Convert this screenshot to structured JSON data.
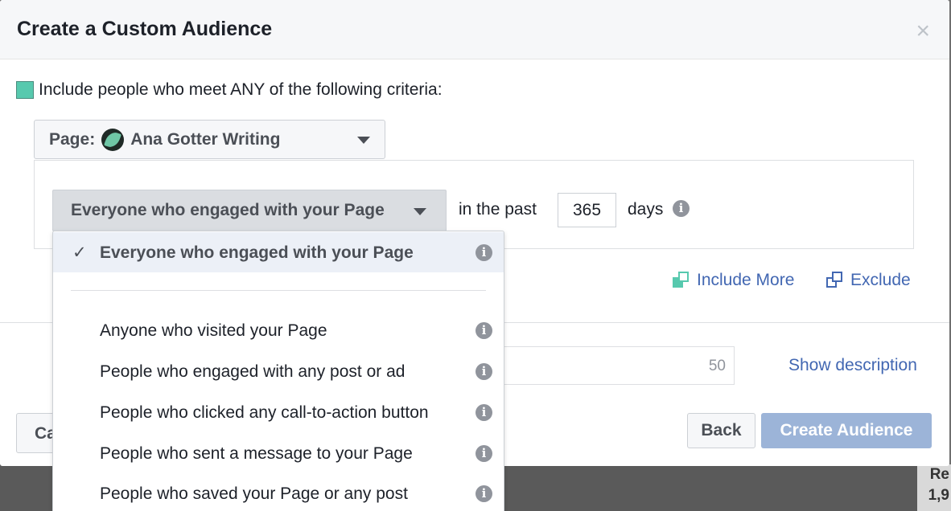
{
  "dialog": {
    "title": "Create a Custom Audience",
    "close_symbol": "×"
  },
  "criteria": {
    "text": "Include people who meet ANY of the following criteria:"
  },
  "page_select": {
    "label": "Page:",
    "page_name": "Ana Gotter Writing"
  },
  "engagement": {
    "selected": "Everyone who engaged with your Page",
    "in_the_past": "in the past",
    "days_value": "365",
    "days_label": "days"
  },
  "links": {
    "include_more": "Include More",
    "exclude": "Exclude"
  },
  "name_field": {
    "char_limit": "50"
  },
  "show_description": "Show description",
  "footer": {
    "cancel_label": "Ca",
    "back_label": "Back",
    "create_label": "Create Audience"
  },
  "dropdown": {
    "selected_item": "Everyone who engaged with your Page",
    "items": [
      "Anyone who visited your Page",
      "People who engaged with any post or ad",
      "People who clicked any call-to-action button",
      "People who sent a message to your Page",
      "People who saved your Page or any post"
    ]
  },
  "info_glyph": "i",
  "check_glyph": "✓",
  "background_text": [
    "Re",
    "1,9"
  ],
  "colors": {
    "accent_link": "#4267b2",
    "primary_button_disabled": "#9cb4d8",
    "criteria_swatch": "#57c9ae"
  }
}
